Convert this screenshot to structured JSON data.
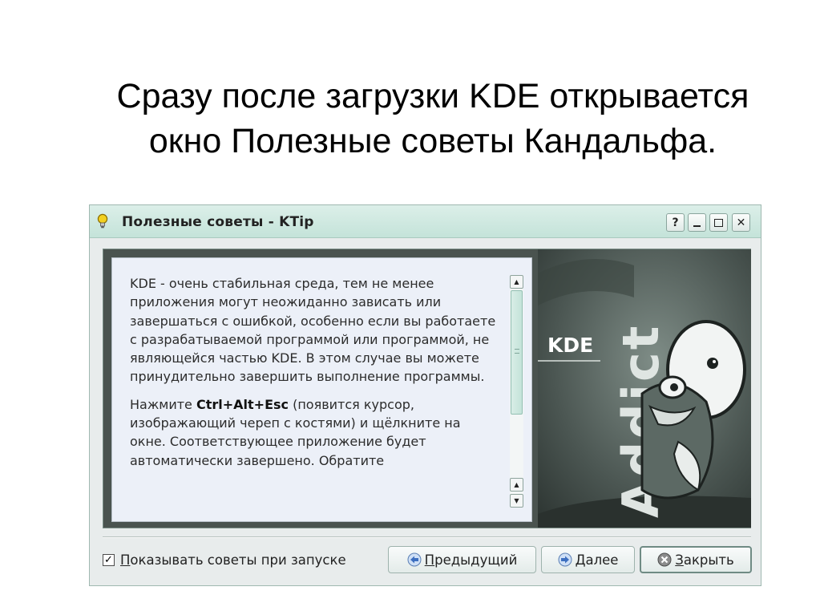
{
  "slide": {
    "title_line1": "Сразу после загрузки KDE открывается",
    "title_line2": "окно Полезные советы Кандальфа."
  },
  "window": {
    "title": "Полезные советы - KTip",
    "help_glyph": "?",
    "close_glyph": "✕"
  },
  "tip": {
    "paragraph1": "KDE - очень стабильная среда, тем не менее приложения могут неожиданно зависать или завершаться с ошибкой, особенно если вы работаете с разрабатываемой программой или программой, не являющейся частью KDE. В этом случае вы можете принудительно завершить выполнение программы.",
    "p2_before": "Нажмите ",
    "p2_keys": "Ctrl+Alt+Esc",
    "p2_after": " (появится курсор, изображающий череп с костями) и щёлкните на окне. Соответствующее приложение будет автоматически завершено. Обратите"
  },
  "artwork": {
    "label": "KDE",
    "vertical_text": "Addict",
    "colors": {
      "dark": "#2e3633",
      "mid": "#6c7a74",
      "light": "#e6ece9"
    }
  },
  "footer": {
    "show_tips_checked": true,
    "check_mark": "✓",
    "show_tips_mnemonic": "П",
    "show_tips_rest": "оказывать советы при запуске",
    "prev_mnemonic": "П",
    "prev_rest": "редыдущий",
    "next_mnemonic": "Д",
    "next_rest": "алее",
    "close_mnemonic": "З",
    "close_rest": "акрыть"
  },
  "icons": {
    "title": "lightbulb-icon",
    "prev": "arrow-left-icon",
    "next": "arrow-right-icon",
    "close": "cancel-icon"
  },
  "colors": {
    "titlebar": "#c4e3d9",
    "tip_background": "#ecf0f8",
    "window_background": "#e8ecec"
  }
}
